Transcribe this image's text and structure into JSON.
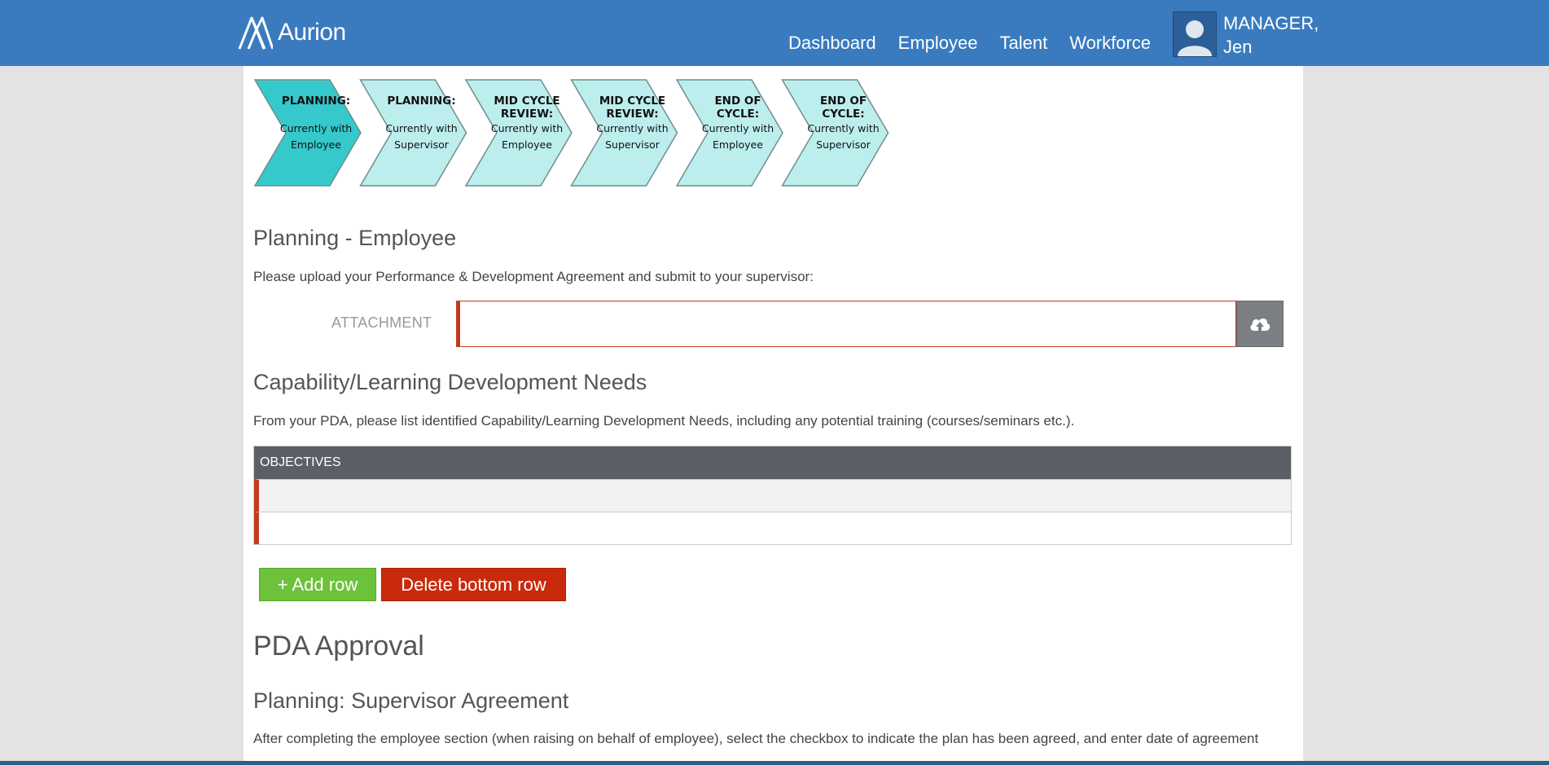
{
  "header": {
    "brand": "Aurion",
    "nav": [
      "Dashboard",
      "Employee",
      "Talent",
      "Workforce"
    ],
    "user_line1": "MANAGER,",
    "user_line2": "Jen"
  },
  "workflow": [
    {
      "title": [
        "PLANNING:"
      ],
      "sub": [
        "Currently with",
        "Employee"
      ],
      "active": true
    },
    {
      "title": [
        "PLANNING:"
      ],
      "sub": [
        "Currently with",
        "Supervisor"
      ],
      "active": false
    },
    {
      "title": [
        "MID CYCLE",
        "REVIEW:"
      ],
      "sub": [
        "Currently with",
        "Employee"
      ],
      "active": false
    },
    {
      "title": [
        "MID CYCLE",
        "REVIEW:"
      ],
      "sub": [
        "Currently with",
        "Supervisor"
      ],
      "active": false
    },
    {
      "title": [
        "END OF",
        "CYCLE:"
      ],
      "sub": [
        "Currently with",
        "Employee"
      ],
      "active": false
    },
    {
      "title": [
        "END OF",
        "CYCLE:"
      ],
      "sub": [
        "Currently with",
        "Supervisor"
      ],
      "active": false
    }
  ],
  "planning": {
    "heading": "Planning - Employee",
    "instruction": "Please upload your Performance & Development Agreement and submit to your supervisor:",
    "attachment_label": "ATTACHMENT",
    "attachment_value": ""
  },
  "capability": {
    "heading": "Capability/Learning Development Needs",
    "instruction": "From your PDA, please list identified Capability/Learning Development Needs, including any potential training (courses/seminars etc.).",
    "column_header": "OBJECTIVES",
    "rows": [
      "",
      ""
    ]
  },
  "buttons": {
    "add_row": "+ Add row",
    "delete_row": "Delete bottom row"
  },
  "approval": {
    "heading": "PDA Approval",
    "subheading": "Planning: Supervisor Agreement",
    "instruction": "After completing the employee section (when raising on behalf of employee), select the checkbox to indicate the plan has been agreed, and enter date of agreement"
  },
  "colors": {
    "header_bg": "#3a7bbf",
    "step_active": "#35c9cc",
    "step_inactive": "#bdeeee",
    "add_button": "#6cc23a",
    "delete_button": "#c92a0c",
    "required_marker": "#c23a1e"
  }
}
